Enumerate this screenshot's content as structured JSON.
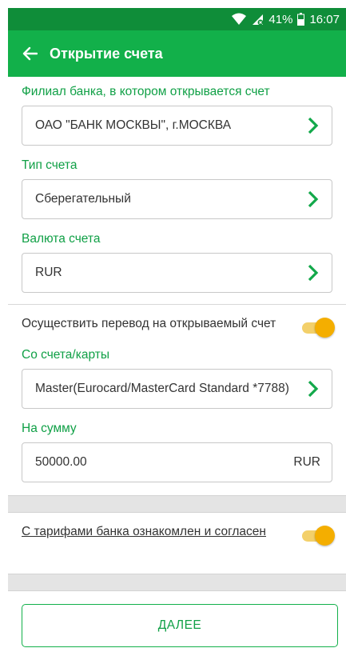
{
  "status_bar": {
    "battery": "41%",
    "time": "16:07"
  },
  "header": {
    "title": "Открытие счета"
  },
  "branch": {
    "label": "Филиал банка, в котором открывается счет",
    "value": "ОАО \"БАНК МОСКВЫ\", г.МОСКВА"
  },
  "account_type": {
    "label": "Тип счета",
    "value": "Сберегательный"
  },
  "currency": {
    "label": "Валюта счета",
    "value": "RUR"
  },
  "transfer_toggle": {
    "label": "Осуществить перевод на открываемый счет",
    "on": true
  },
  "from_account": {
    "label": "Со счета/карты",
    "value": "Master(Eurocard/MasterCard Standard *7788)"
  },
  "amount": {
    "label": "На сумму",
    "value": "50000.00",
    "currency": "RUR"
  },
  "tariffs_toggle": {
    "label": "С тарифами банка ознакомлен и согласен",
    "on": true
  },
  "next_button": {
    "label": "ДАЛЕЕ"
  },
  "colors": {
    "status_bar": "#0f8d39",
    "app_bar": "#12b04a",
    "accent_green": "#10a046",
    "toggle_on": "#f4ae00"
  }
}
